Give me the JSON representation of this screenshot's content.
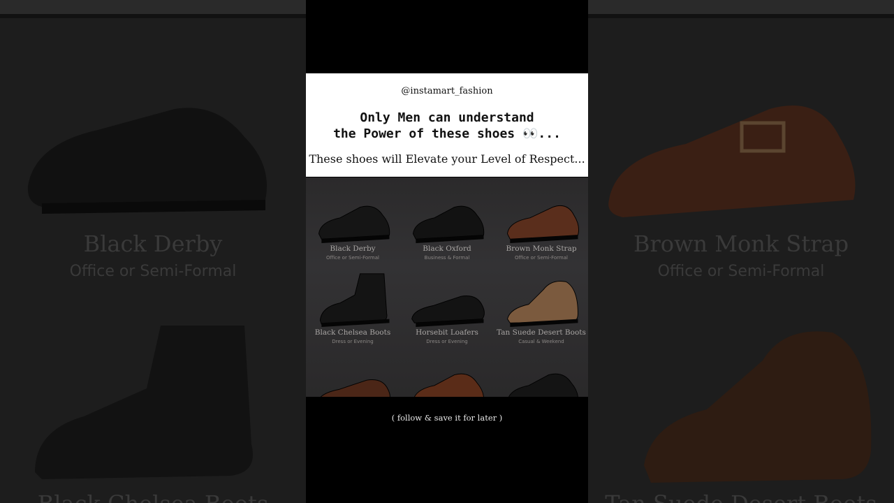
{
  "header": {
    "handle": "@instamart_fashion",
    "headline_line1": "Only Men can understand",
    "headline_line2": "the Power of these shoes 👀...",
    "tagline": "These shoes will Elevate your Level of Respect..."
  },
  "shoes": [
    {
      "name": "Black Derby",
      "use": "Office or Semi-Formal",
      "color": "#151515"
    },
    {
      "name": "Black Oxford",
      "use": "Business & Formal",
      "color": "#121212"
    },
    {
      "name": "Brown Monk Strap",
      "use": "Office or Semi-Formal",
      "color": "#5a2e1c"
    },
    {
      "name": "Black Chelsea Boots",
      "use": "Dress or Evening",
      "color": "#141414"
    },
    {
      "name": "Horsebit Loafers",
      "use": "Dress or Evening",
      "color": "#131313"
    },
    {
      "name": "Tan Suede Desert Boots",
      "use": "Casual & Weekend",
      "color": "#7b5a3e"
    },
    {
      "name": "",
      "use": "",
      "color": "#4b2617"
    },
    {
      "name": "",
      "use": "",
      "color": "#5a2c18"
    },
    {
      "name": "",
      "use": "",
      "color": "#141414"
    }
  ],
  "background": {
    "left_title": "Black Derby",
    "left_sub": "Office or Semi-Formal",
    "left_bottom": "Black Chelsea Boots",
    "right_title": "Brown Monk Strap",
    "right_sub": "Office or Semi-Formal",
    "right_bottom": "Tan Suede Desert Boots"
  },
  "cta": "( follow & save it for later )"
}
